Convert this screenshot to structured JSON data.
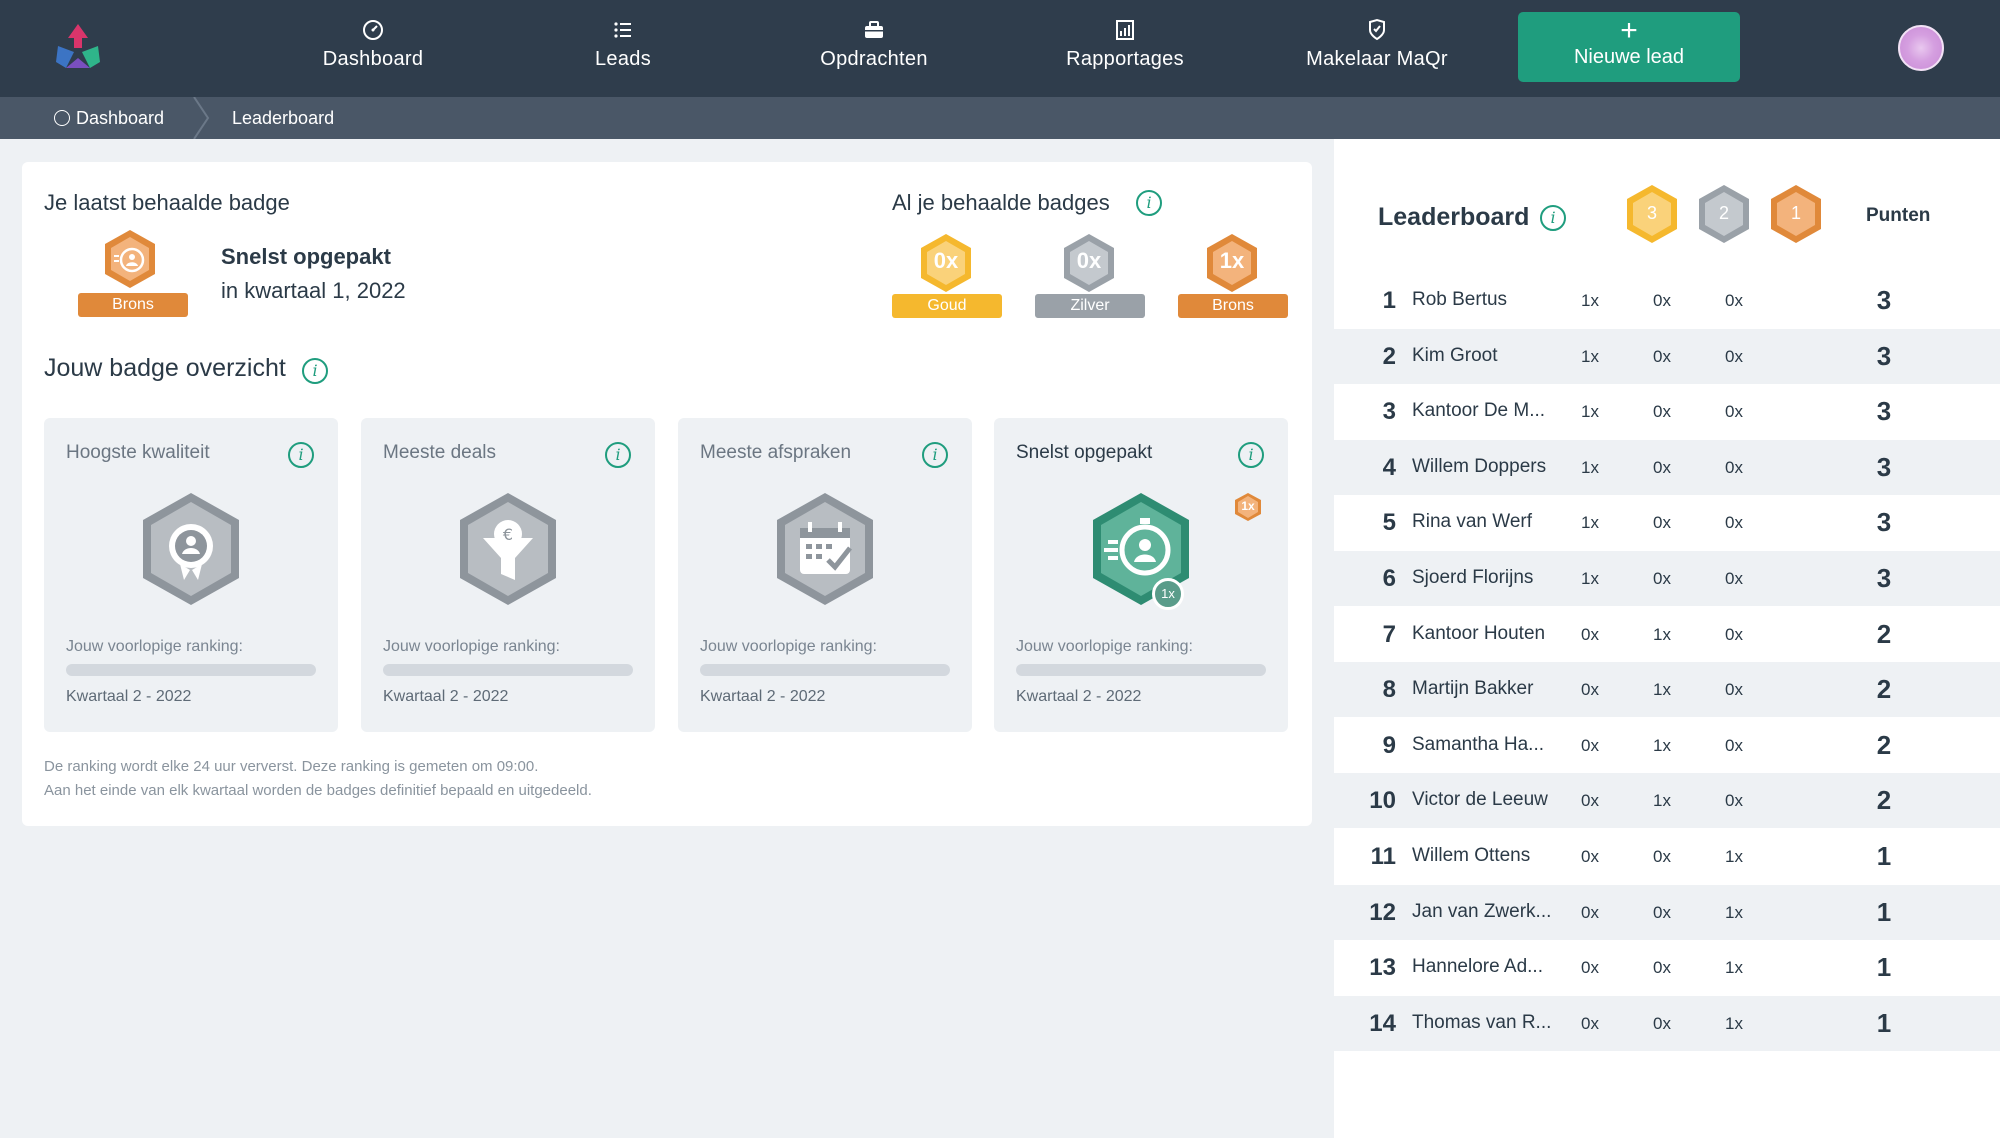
{
  "nav": {
    "items": [
      {
        "label": "Dashboard",
        "icon": "dashboard-icon"
      },
      {
        "label": "Leads",
        "icon": "list-icon"
      },
      {
        "label": "Opdrachten",
        "icon": "briefcase-icon"
      },
      {
        "label": "Rapportages",
        "icon": "report-icon"
      },
      {
        "label": "Makelaar MaQr",
        "icon": "makelaar-icon"
      }
    ],
    "new_lead_label": "Nieuwe lead",
    "new_lead_icon": "plus-icon"
  },
  "breadcrumb": {
    "items": [
      "Dashboard",
      "Leaderboard"
    ]
  },
  "latest_badge": {
    "heading": "Je laatst behaalde badge",
    "badge_level": "Brons",
    "badge_name": "Snelst opgepakt",
    "period": "in kwartaal 1, 2022"
  },
  "all_badges": {
    "heading": "Al je behaalde badges",
    "items": [
      {
        "count": "0x",
        "label": "Goud",
        "color": "#f5b82e"
      },
      {
        "count": "0x",
        "label": "Zilver",
        "color": "#9aa1a8"
      },
      {
        "count": "1x",
        "label": "Brons",
        "color": "#e0893a"
      }
    ]
  },
  "overview": {
    "heading": "Jouw badge overzicht",
    "cards": [
      {
        "title": "Hoogste kwaliteit",
        "ranking_label": "Jouw voorlopige ranking:",
        "period": "Kwartaal 2 - 2022",
        "icon": "quality-icon",
        "active": false
      },
      {
        "title": "Meeste deals",
        "ranking_label": "Jouw voorlopige ranking:",
        "period": "Kwartaal 2 - 2022",
        "icon": "euro-funnel-icon",
        "active": false
      },
      {
        "title": "Meeste afspraken",
        "ranking_label": "Jouw voorlopige ranking:",
        "period": "Kwartaal 2 - 2022",
        "icon": "calendar-check-icon",
        "active": false
      },
      {
        "title": "Snelst opgepakt",
        "ranking_label": "Jouw voorlopige ranking:",
        "period": "Kwartaal 2 - 2022",
        "icon": "stopwatch-person-icon",
        "active": true,
        "earned": "1x",
        "corner_badge": "1x"
      }
    ],
    "footnote_1": "De ranking wordt elke 24 uur ververst. Deze ranking is gemeten om 09:00.",
    "footnote_2": "Aan het einde van elk kwartaal worden de badges definitief bepaald en uitgedeeld."
  },
  "leaderboard": {
    "title": "Leaderboard",
    "header_counts": [
      "3",
      "2",
      "1"
    ],
    "header_colors": [
      "#f5b82e",
      "#9aa1a8",
      "#e0893a"
    ],
    "points_label": "Punten",
    "rows": [
      {
        "rank": "1",
        "name": "Rob Bertus",
        "gold": "1x",
        "silver": "0x",
        "bronze": "0x",
        "points": "3"
      },
      {
        "rank": "2",
        "name": "Kim Groot",
        "gold": "1x",
        "silver": "0x",
        "bronze": "0x",
        "points": "3"
      },
      {
        "rank": "3",
        "name": "Kantoor De M...",
        "gold": "1x",
        "silver": "0x",
        "bronze": "0x",
        "points": "3"
      },
      {
        "rank": "4",
        "name": "Willem Doppers",
        "gold": "1x",
        "silver": "0x",
        "bronze": "0x",
        "points": "3"
      },
      {
        "rank": "5",
        "name": "Rina van Werf",
        "gold": "1x",
        "silver": "0x",
        "bronze": "0x",
        "points": "3"
      },
      {
        "rank": "6",
        "name": "Sjoerd Florijns",
        "gold": "1x",
        "silver": "0x",
        "bronze": "0x",
        "points": "3"
      },
      {
        "rank": "7",
        "name": "Kantoor Houten",
        "gold": "0x",
        "silver": "1x",
        "bronze": "0x",
        "points": "2"
      },
      {
        "rank": "8",
        "name": "Martijn Bakker",
        "gold": "0x",
        "silver": "1x",
        "bronze": "0x",
        "points": "2"
      },
      {
        "rank": "9",
        "name": "Samantha Ha...",
        "gold": "0x",
        "silver": "1x",
        "bronze": "0x",
        "points": "2"
      },
      {
        "rank": "10",
        "name": "Victor de Leeuw",
        "gold": "0x",
        "silver": "1x",
        "bronze": "0x",
        "points": "2"
      },
      {
        "rank": "11",
        "name": "Willem Ottens",
        "gold": "0x",
        "silver": "0x",
        "bronze": "1x",
        "points": "1"
      },
      {
        "rank": "12",
        "name": "Jan van Zwerk...",
        "gold": "0x",
        "silver": "0x",
        "bronze": "1x",
        "points": "1"
      },
      {
        "rank": "13",
        "name": "Hannelore Ad...",
        "gold": "0x",
        "silver": "0x",
        "bronze": "1x",
        "points": "1"
      },
      {
        "rank": "14",
        "name": "Thomas van R...",
        "gold": "0x",
        "silver": "0x",
        "bronze": "1x",
        "points": "1"
      }
    ]
  },
  "colors": {
    "nav_bg": "#2f3d4c",
    "accent": "#1f9d7e",
    "gold": "#f5b82e",
    "silver": "#9aa1a8",
    "bronze": "#e0893a"
  }
}
